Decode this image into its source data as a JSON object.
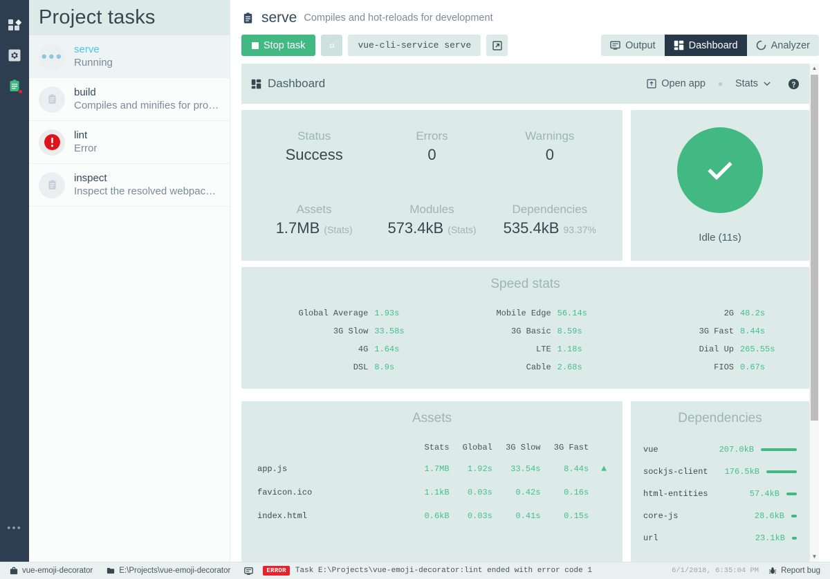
{
  "rail": {
    "items": [
      {
        "name": "plugins-icon",
        "label": "Plugins"
      },
      {
        "name": "configuration-icon",
        "label": "Configuration"
      },
      {
        "name": "tasks-icon",
        "label": "Tasks"
      }
    ],
    "more_label": "•••"
  },
  "left": {
    "title": "Project tasks",
    "tasks": [
      {
        "name": "serve",
        "status": "Running",
        "icon": "dots-icon",
        "active": true
      },
      {
        "name": "build",
        "status": "Compiles and minifies for pro…",
        "icon": "clipboard-icon",
        "active": false
      },
      {
        "name": "lint",
        "status": "Error",
        "icon": "error-icon",
        "active": false
      },
      {
        "name": "inspect",
        "status": "Inspect the resolved webpack…",
        "icon": "clipboard-icon",
        "active": false
      }
    ]
  },
  "task_header": {
    "icon": "clipboard-icon",
    "title": "serve",
    "description": "Compiles and hot-reloads for development"
  },
  "toolbar": {
    "stop_label": "Stop task",
    "settings_icon": "gear-icon",
    "command": "vue-cli-service serve",
    "open_icon": "external-link-icon",
    "tabs": [
      {
        "label": "Output",
        "icon": "terminal-icon",
        "selected": false
      },
      {
        "label": "Dashboard",
        "icon": "dashboard-icon",
        "selected": true
      },
      {
        "label": "Analyzer",
        "icon": "analyzer-icon",
        "selected": false
      }
    ]
  },
  "dashboard": {
    "header": {
      "title": "Dashboard",
      "open_app": "Open app",
      "stats": "Stats",
      "help_icon": "help-icon"
    },
    "summary": [
      {
        "label": "Status",
        "value": "Success",
        "sub": ""
      },
      {
        "label": "Errors",
        "value": "0",
        "sub": ""
      },
      {
        "label": "Warnings",
        "value": "0",
        "sub": ""
      },
      {
        "label": "Assets",
        "value": "1.7MB",
        "sub": "(Stats)"
      },
      {
        "label": "Modules",
        "value": "573.4kB",
        "sub": "(Stats)"
      },
      {
        "label": "Dependencies",
        "value": "535.4kB",
        "sub": "93.37%"
      }
    ],
    "idle": {
      "icon": "check-icon",
      "label": "Idle (11s)",
      "color": "#42b983"
    },
    "speed": {
      "title": "Speed stats",
      "columns": [
        [
          {
            "name": "Global Average",
            "value": "1.93s"
          },
          {
            "name": "3G Slow",
            "value": "33.58s"
          },
          {
            "name": "4G",
            "value": "1.64s"
          },
          {
            "name": "DSL",
            "value": "8.9s"
          }
        ],
        [
          {
            "name": "Mobile Edge",
            "value": "56.14s"
          },
          {
            "name": "3G Basic",
            "value": "8.59s"
          },
          {
            "name": "LTE",
            "value": "1.18s"
          },
          {
            "name": "Cable",
            "value": "2.68s"
          }
        ],
        [
          {
            "name": "2G",
            "value": "48.2s"
          },
          {
            "name": "3G Fast",
            "value": "8.44s"
          },
          {
            "name": "Dial Up",
            "value": "265.55s"
          },
          {
            "name": "FIOS",
            "value": "0.67s"
          }
        ]
      ]
    },
    "assets": {
      "title": "Assets",
      "headers": [
        "",
        "Stats",
        "Global",
        "3G Slow",
        "3G Fast",
        ""
      ],
      "rows": [
        {
          "name": "app.js",
          "stats": "1.7MB",
          "global": "1.92s",
          "g3slow": "33.54s",
          "g3fast": "8.44s",
          "flag": "▲"
        },
        {
          "name": "favicon.ico",
          "stats": "1.1kB",
          "global": "0.03s",
          "g3slow": "0.42s",
          "g3fast": "0.16s",
          "flag": ""
        },
        {
          "name": "index.html",
          "stats": "0.6kB",
          "global": "0.03s",
          "g3slow": "0.41s",
          "g3fast": "0.15s",
          "flag": ""
        }
      ]
    },
    "dependencies": {
      "title": "Dependencies",
      "rows": [
        {
          "name": "vue",
          "size": "207.0kB",
          "bar": 100
        },
        {
          "name": "sockjs-client",
          "size": "176.5kB",
          "bar": 85
        },
        {
          "name": "html-entities",
          "size": "57.4kB",
          "bar": 28
        },
        {
          "name": "core-js",
          "size": "28.6kB",
          "bar": 14
        },
        {
          "name": "url",
          "size": "23.1kB",
          "bar": 11
        }
      ]
    }
  },
  "statusbar": {
    "project_icon": "briefcase-icon",
    "project": "vue-emoji-decorator",
    "folder_icon": "folder-icon",
    "path": "E:\\Projects\\vue-emoji-decorator",
    "console_icon": "terminal-icon",
    "error_badge": "ERROR",
    "message": "Task E:\\Projects\\vue-emoji-decorator:lint ended with error code 1",
    "timestamp": "6/1/2018, 6:35:04 PM",
    "bug_icon": "bug-icon",
    "report_bug": "Report bug"
  }
}
